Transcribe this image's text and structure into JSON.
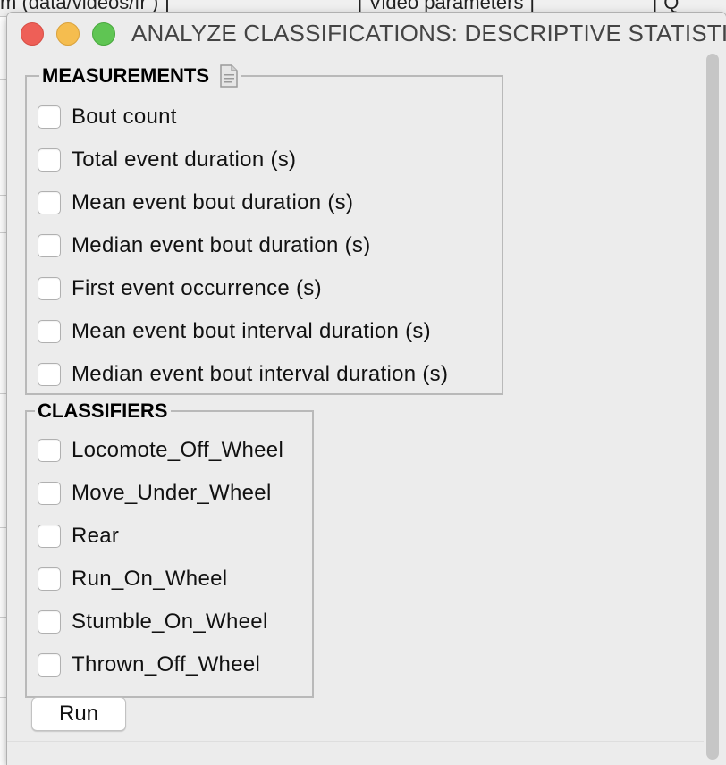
{
  "window": {
    "title": "ANALYZE CLASSIFICATIONS: DESCRIPTIVE STATISTICS"
  },
  "background": {
    "top_text_1": "m    (data/videos/fr    ) ]",
    "top_text_2": "[ Video parameters ]",
    "top_text_3": "[ Q"
  },
  "measurements": {
    "title": "MEASUREMENTS",
    "items": [
      {
        "label": "Bout count",
        "checked": false
      },
      {
        "label": "Total event duration (s)",
        "checked": false
      },
      {
        "label": "Mean event bout duration (s)",
        "checked": false
      },
      {
        "label": "Median event bout duration (s)",
        "checked": false
      },
      {
        "label": "First event occurrence (s)",
        "checked": false
      },
      {
        "label": "Mean event bout interval duration (s)",
        "checked": false
      },
      {
        "label": "Median event bout interval duration (s)",
        "checked": false
      }
    ]
  },
  "classifiers": {
    "title": "CLASSIFIERS",
    "items": [
      {
        "label": "Locomote_Off_Wheel",
        "checked": false
      },
      {
        "label": "Move_Under_Wheel",
        "checked": false
      },
      {
        "label": "Rear",
        "checked": false
      },
      {
        "label": "Run_On_Wheel",
        "checked": false
      },
      {
        "label": "Stumble_On_Wheel",
        "checked": false
      },
      {
        "label": "Thrown_Off_Wheel",
        "checked": false
      }
    ]
  },
  "actions": {
    "run_label": "Run"
  },
  "colors": {
    "close": "#ee5f57",
    "minimize": "#f5bd4f",
    "maximize": "#5fc553",
    "window_bg": "#ececec"
  }
}
